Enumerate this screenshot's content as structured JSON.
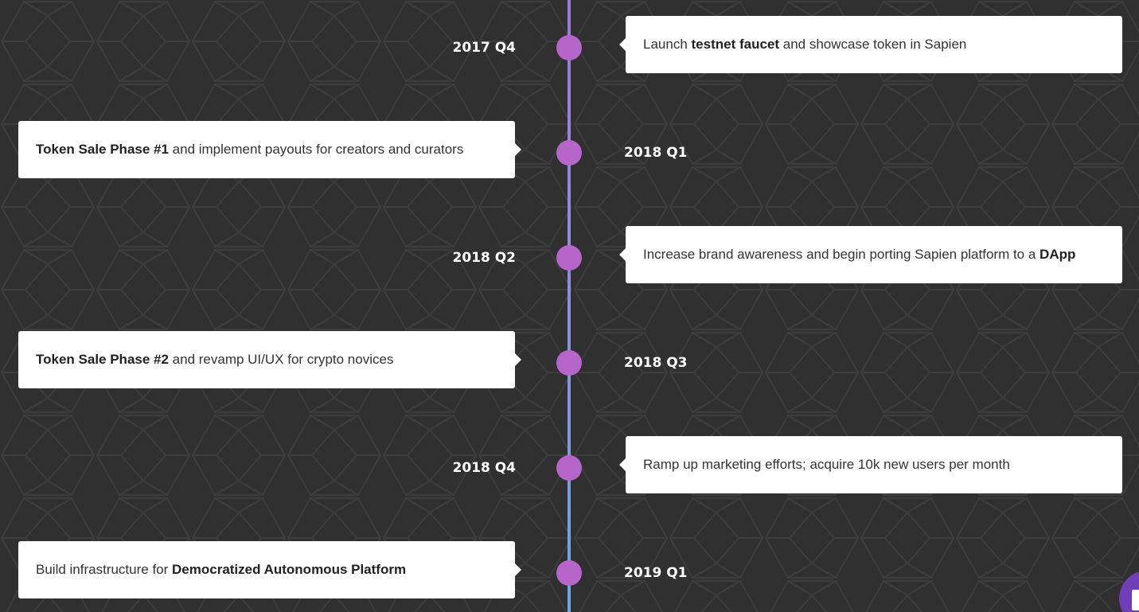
{
  "theme": {
    "background": "#303030",
    "card_background": "#ffffff",
    "dot_color": "#b566c8",
    "line_color_top": "#9b7fd0",
    "line_color_bottom": "#6fa8d8",
    "chat_color": "#6e3fb7"
  },
  "timeline": [
    {
      "date": "2017 Q4",
      "side": "right",
      "text": [
        {
          "t": "Launch ",
          "bold": false
        },
        {
          "t": "testnet faucet",
          "bold": true
        },
        {
          "t": " and showcase token in Sapien",
          "bold": false
        }
      ]
    },
    {
      "date": "2018 Q1",
      "side": "left",
      "text": [
        {
          "t": "Token Sale Phase #1",
          "bold": true
        },
        {
          "t": " and implement payouts for creators and curators",
          "bold": false
        }
      ]
    },
    {
      "date": "2018 Q2",
      "side": "right",
      "text": [
        {
          "t": "Increase brand awareness and begin porting Sapien platform to a ",
          "bold": false
        },
        {
          "t": "DApp",
          "bold": true
        }
      ]
    },
    {
      "date": "2018 Q3",
      "side": "left",
      "text": [
        {
          "t": "Token Sale Phase #2",
          "bold": true
        },
        {
          "t": " and revamp UI/UX for crypto novices",
          "bold": false
        }
      ]
    },
    {
      "date": "2018 Q4",
      "side": "right",
      "text": [
        {
          "t": "Ramp up marketing efforts; acquire 10k new users per month",
          "bold": false
        }
      ]
    },
    {
      "date": "2019 Q1",
      "side": "left",
      "text": [
        {
          "t": "Build infrastructure for ",
          "bold": false
        },
        {
          "t": "Democratized Autonomous Platform",
          "bold": true
        }
      ]
    }
  ],
  "chat_widget": {
    "icon": "chat-icon"
  }
}
